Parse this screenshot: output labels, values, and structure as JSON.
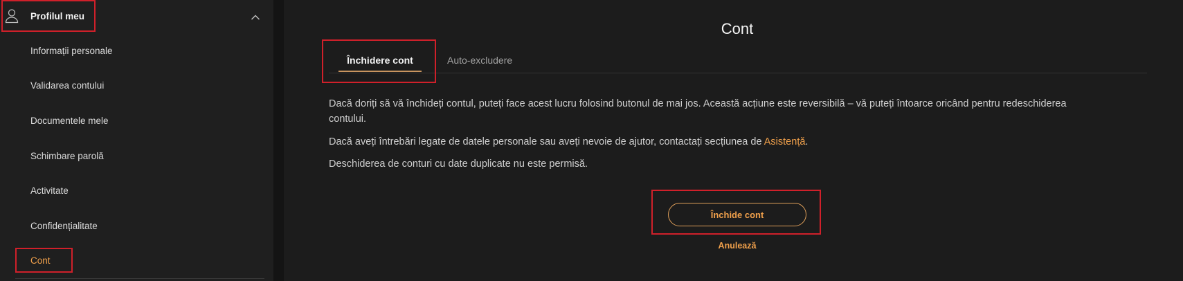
{
  "sidebar": {
    "header": {
      "label": "Profilul meu",
      "icon": "user-icon",
      "toggle_icon": "chevron-up-icon"
    },
    "items": [
      {
        "label": "Informații personale",
        "active": false
      },
      {
        "label": "Validarea contului",
        "active": false
      },
      {
        "label": "Documentele mele",
        "active": false
      },
      {
        "label": "Schimbare parolă",
        "active": false
      },
      {
        "label": "Activitate",
        "active": false
      },
      {
        "label": "Confidențialitate",
        "active": false
      },
      {
        "label": "Cont",
        "active": true
      }
    ]
  },
  "main": {
    "title": "Cont",
    "tabs": [
      {
        "label": "Închidere cont",
        "active": true
      },
      {
        "label": "Auto-excludere",
        "active": false
      }
    ],
    "p1": "Dacă doriți să vă închideți contul, puteți face acest lucru folosind butonul de mai jos. Această acțiune este reversibilă – vă puteți întoarce oricând pentru redeschiderea contului.",
    "p2_before": "Dacă aveți întrebări legate de datele personale sau aveți nevoie de ajutor, contactați secțiunea de ",
    "p2_link": "Asistență",
    "p2_after": ".",
    "p3": "Deschiderea de conturi cu date duplicate nu este permisă.",
    "close_button": "Închide cont",
    "cancel_link": "Anulează"
  },
  "colors": {
    "accent": "#f0a04b",
    "sidebar_bg": "#1f1f1f",
    "main_bg": "#1c1c1c",
    "highlight_box": "#d0202a"
  }
}
